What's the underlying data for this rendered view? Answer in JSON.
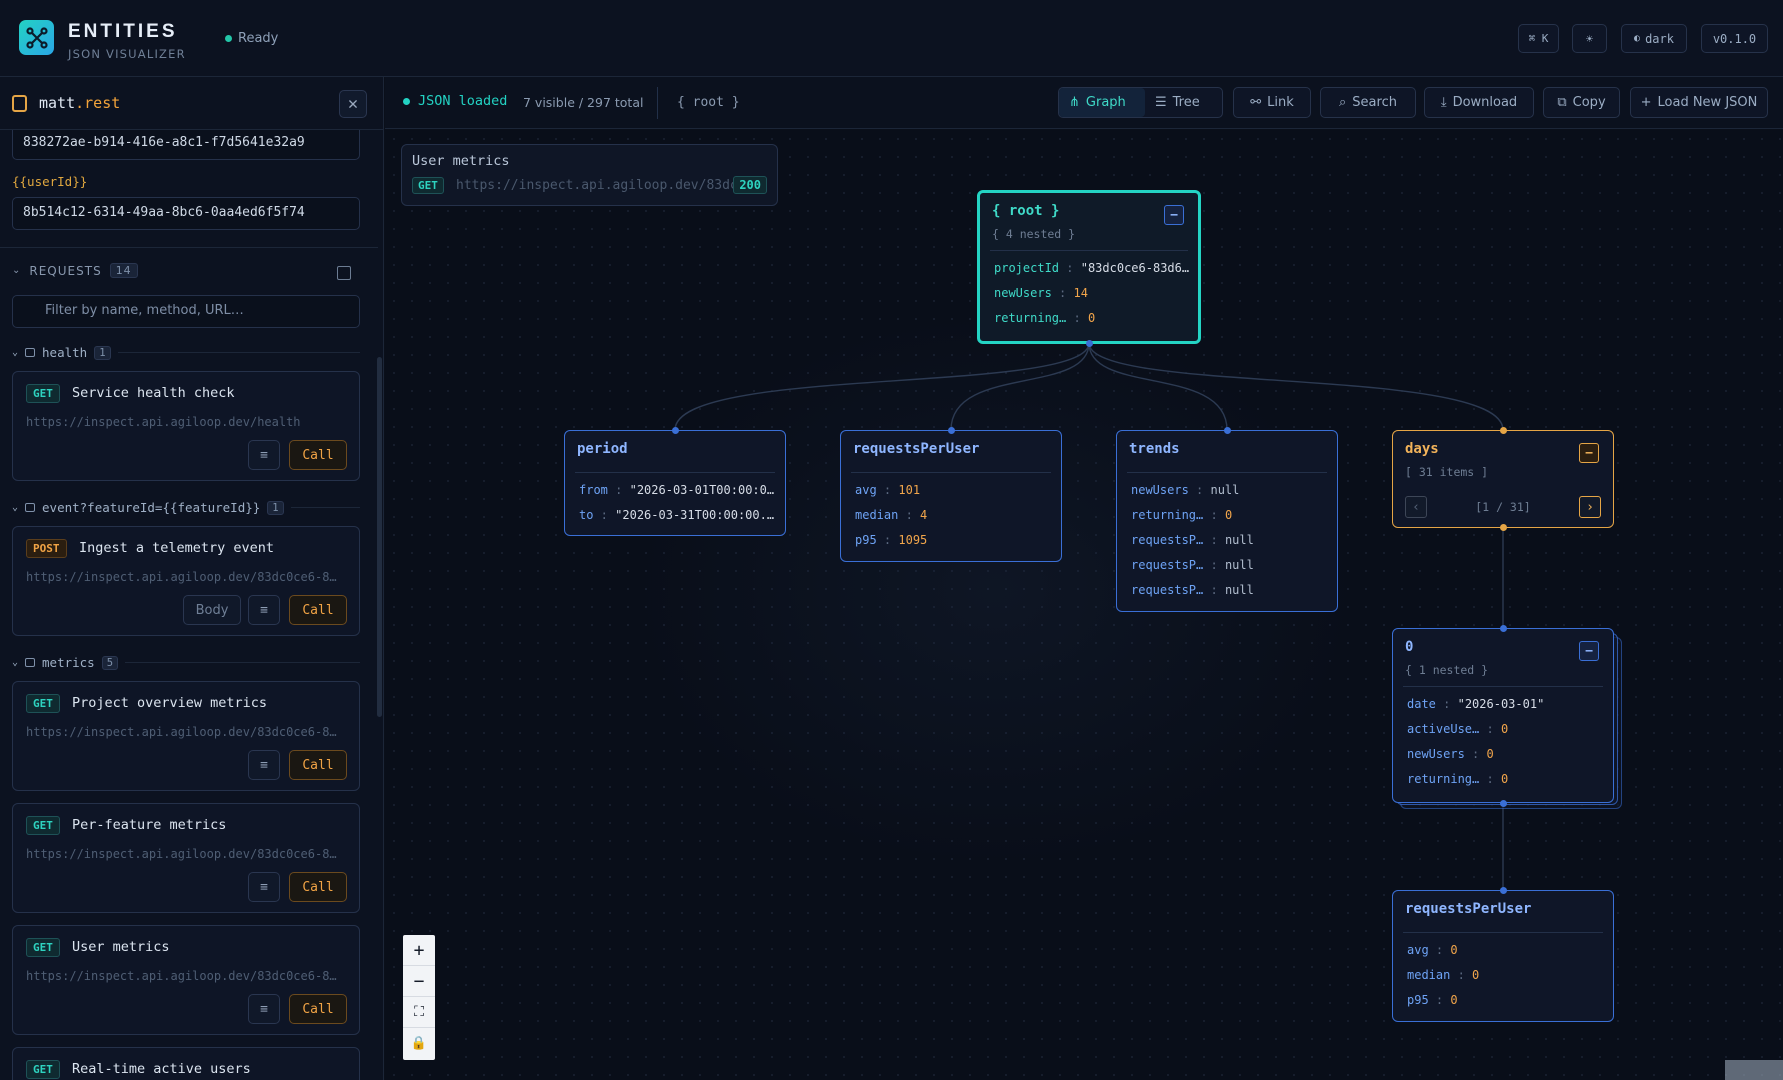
{
  "header": {
    "brand_title": "ENTITIES",
    "brand_subtitle": "JSON VISUALIZER",
    "status": "Ready",
    "shortcut": "⌘ K",
    "theme_label": "dark",
    "version": "v0.1.0"
  },
  "sidebar": {
    "file_name": "matt",
    "file_ext": ".rest",
    "field1_value": "838272ae-b914-416e-a8c1-f7d5641e32a9",
    "var_label": "{{userId}}",
    "field2_value": "8b514c12-6314-49aa-8bc6-0aa4ed6f5f74",
    "requests_label": "REQUESTS",
    "requests_count": "14",
    "filter_placeholder": "Filter by name, method, URL…",
    "groups": [
      {
        "name": "health",
        "count": "1"
      },
      {
        "name": "event?featureId={{featureId}}",
        "count": "1"
      },
      {
        "name": "metrics",
        "count": "5"
      }
    ],
    "cards": [
      {
        "method": "GET",
        "title": "Service health check",
        "url": "https://inspect.api.agiloop.dev/health",
        "call": "Call"
      },
      {
        "method": "POST",
        "title": "Ingest a telemetry event",
        "url": "https://inspect.api.agiloop.dev/83dc0ce6-8…",
        "body": "Body",
        "call": "Call"
      },
      {
        "method": "GET",
        "title": "Project overview metrics",
        "url": "https://inspect.api.agiloop.dev/83dc0ce6-8…",
        "call": "Call"
      },
      {
        "method": "GET",
        "title": "Per-feature metrics",
        "url": "https://inspect.api.agiloop.dev/83dc0ce6-8…",
        "call": "Call"
      },
      {
        "method": "GET",
        "title": "User metrics",
        "url": "https://inspect.api.agiloop.dev/83dc0ce6-8…",
        "call": "Call"
      },
      {
        "method": "GET",
        "title": "Real-time active users"
      }
    ]
  },
  "toolbar": {
    "loaded": "JSON loaded",
    "visible": "7 visible / 297 total",
    "root": "{ root }",
    "graph": "Graph",
    "tree": "Tree",
    "link": "Link",
    "search": "Search",
    "download": "Download",
    "copy": "Copy",
    "load_new": "Load New JSON"
  },
  "request_box": {
    "title": "User metrics",
    "method": "GET",
    "url": "https://inspect.api.agiloop.dev/83dc0c…",
    "status_code": "200"
  },
  "nodes": {
    "root": {
      "title": "{ root }",
      "sub": "{ 4 nested }",
      "props": [
        {
          "k": "projectId",
          "v": "\"83dc0ce6-83d6…"
        },
        {
          "k": "newUsers",
          "v": "14"
        },
        {
          "k": "returning…",
          "v": "0"
        }
      ]
    },
    "period": {
      "title": "period",
      "props": [
        {
          "k": "from",
          "v": "\"2026-03-01T00:00:0…"
        },
        {
          "k": "to",
          "v": "\"2026-03-31T00:00:00.…"
        }
      ]
    },
    "requestsPerUser": {
      "title": "requestsPerUser",
      "props": [
        {
          "k": "avg",
          "v": "101"
        },
        {
          "k": "median",
          "v": "4"
        },
        {
          "k": "p95",
          "v": "1095"
        }
      ]
    },
    "trends": {
      "title": "trends",
      "props": [
        {
          "k": "newUsers",
          "v": "null"
        },
        {
          "k": "returning…",
          "v": "0"
        },
        {
          "k": "requestsP…",
          "v": "null"
        },
        {
          "k": "requestsP…",
          "v": "null"
        },
        {
          "k": "requestsP…",
          "v": "null"
        }
      ]
    },
    "days": {
      "title": "days",
      "sub": "[ 31 items ]",
      "pager": "[1 / 31]"
    },
    "item0": {
      "title": "0",
      "sub": "{ 1 nested }",
      "props": [
        {
          "k": "date",
          "v": "\"2026-03-01\""
        },
        {
          "k": "activeUse…",
          "v": "0"
        },
        {
          "k": "newUsers",
          "v": "0"
        },
        {
          "k": "returning…",
          "v": "0"
        }
      ]
    },
    "rpu2": {
      "title": "requestsPerUser",
      "props": [
        {
          "k": "avg",
          "v": "0"
        },
        {
          "k": "median",
          "v": "0"
        },
        {
          "k": "p95",
          "v": "0"
        }
      ]
    }
  },
  "colors": {
    "accent": "#24d4c4",
    "object_border": "#3a6fd6",
    "array_border": "#e5a546",
    "number": "#f1a54b"
  }
}
